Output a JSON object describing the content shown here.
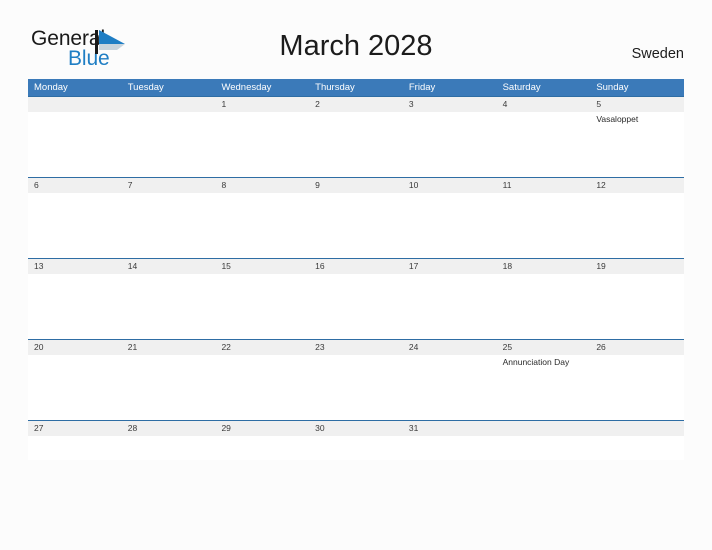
{
  "branding": {
    "logo_text_primary": "General",
    "logo_text_secondary": "Blue",
    "logo_icon": "flag-triangle-icon",
    "accent_color": "#1f7ec4"
  },
  "header": {
    "title": "March 2028",
    "country": "Sweden"
  },
  "theme": {
    "header_bar_color": "#3b7ab9",
    "band_color": "#f0f0f0",
    "band_border_color": "#2e6da4",
    "page_background": "#fcfcfc",
    "text_color": "#1c1c1c"
  },
  "calendar": {
    "month": "March",
    "year": "2028",
    "day_names": [
      "Monday",
      "Tuesday",
      "Wednesday",
      "Thursday",
      "Friday",
      "Saturday",
      "Sunday"
    ],
    "weeks": [
      {
        "days": [
          {
            "number": "",
            "events": []
          },
          {
            "number": "",
            "events": []
          },
          {
            "number": "1",
            "events": []
          },
          {
            "number": "2",
            "events": []
          },
          {
            "number": "3",
            "events": []
          },
          {
            "number": "4",
            "events": []
          },
          {
            "number": "5",
            "events": [
              "Vasaloppet"
            ]
          }
        ]
      },
      {
        "days": [
          {
            "number": "6",
            "events": []
          },
          {
            "number": "7",
            "events": []
          },
          {
            "number": "8",
            "events": []
          },
          {
            "number": "9",
            "events": []
          },
          {
            "number": "10",
            "events": []
          },
          {
            "number": "11",
            "events": []
          },
          {
            "number": "12",
            "events": []
          }
        ]
      },
      {
        "days": [
          {
            "number": "13",
            "events": []
          },
          {
            "number": "14",
            "events": []
          },
          {
            "number": "15",
            "events": []
          },
          {
            "number": "16",
            "events": []
          },
          {
            "number": "17",
            "events": []
          },
          {
            "number": "18",
            "events": []
          },
          {
            "number": "19",
            "events": []
          }
        ]
      },
      {
        "days": [
          {
            "number": "20",
            "events": []
          },
          {
            "number": "21",
            "events": []
          },
          {
            "number": "22",
            "events": []
          },
          {
            "number": "23",
            "events": []
          },
          {
            "number": "24",
            "events": []
          },
          {
            "number": "25",
            "events": [
              "Annunciation Day"
            ]
          },
          {
            "number": "26",
            "events": []
          }
        ]
      },
      {
        "days": [
          {
            "number": "27",
            "events": []
          },
          {
            "number": "28",
            "events": []
          },
          {
            "number": "29",
            "events": []
          },
          {
            "number": "30",
            "events": []
          },
          {
            "number": "31",
            "events": []
          },
          {
            "number": "",
            "events": []
          },
          {
            "number": "",
            "events": []
          }
        ]
      }
    ]
  }
}
